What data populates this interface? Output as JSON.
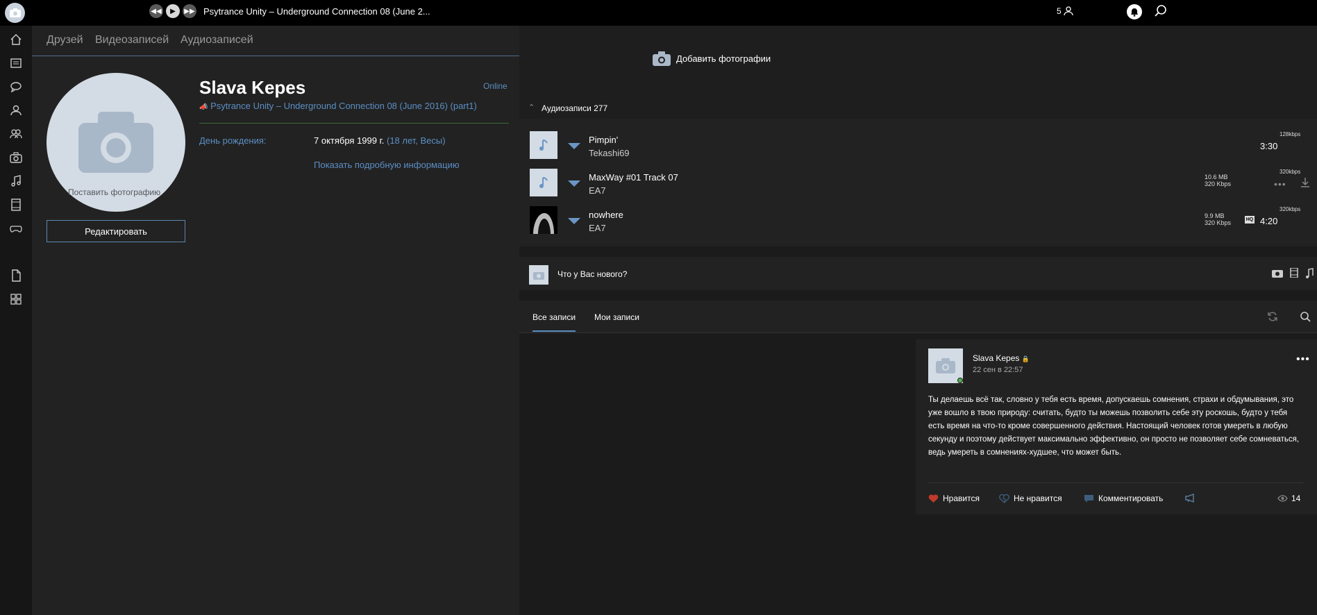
{
  "topbar": {
    "now_playing": "Psytrance Unity – Underground Connection 08 (June 2...",
    "counter": "5"
  },
  "sidebar": {
    "icons": [
      "home-icon",
      "news-icon",
      "messages-icon",
      "profile-icon",
      "groups-icon",
      "photos-icon",
      "music-icon",
      "video-icon",
      "games-icon",
      "documents-icon",
      "apps-icon"
    ]
  },
  "profile": {
    "tabs": [
      "Друзей",
      "Видеозаписей",
      "Аудиозаписей"
    ],
    "name": "Slava Kepes",
    "online": "Online",
    "status_track": "Psytrance Unity – Underground Connection 08 (June 2016) (part1)",
    "birthday_label": "День рождения:",
    "birthday_date": "7 октября 1999 г. ",
    "birthday_extra": "(18 лет, Весы)",
    "show_more": "Показать подробную информацию",
    "avatar_caption": "Поставить фотографию",
    "edit_button": "Редактировать"
  },
  "photos": {
    "add_label": "Добавить фотографии"
  },
  "audio": {
    "title": "Аудиозаписи  277",
    "tracks": [
      {
        "title": "Pimpin'",
        "artist": "Tekashi69",
        "duration": "3:30",
        "kbps": "128kbps",
        "size": "",
        "quality": ""
      },
      {
        "title": "MaxWay #01 Track 07",
        "artist": "EA7",
        "duration": "",
        "kbps": "320kbps",
        "size": "10.6 MB",
        "quality": "320 Kbps"
      },
      {
        "title": "nowhere",
        "artist": "EA7",
        "duration": "4:20",
        "kbps": "320kbps",
        "size": "9.9 MB",
        "quality": "320 Kbps"
      }
    ]
  },
  "composer": {
    "placeholder": "Что у Вас нового?"
  },
  "feed": {
    "tabs": [
      "Все записи",
      "Мои записи"
    ]
  },
  "post": {
    "author": "Slava Kepes",
    "time": "22 сен в 22:57",
    "text": "Ты делаешь всё так, словно у тебя есть время, допускаешь сомнения, страхи и обдумывания, это уже вошло в твою природу: считать, будто ты можешь позволить себе эту роскошь, будто у тебя есть время на что-то кроме совершенного действия. Настоящий человек готов умереть в любую секунду и поэтому действует максимально эффективно, он просто не позволяет себе сомневаться, ведь умереть в сомнениях-худшее, что может быть.",
    "like": "Нравится",
    "dislike": "Не нравится",
    "comment": "Комментировать",
    "views": "14"
  }
}
